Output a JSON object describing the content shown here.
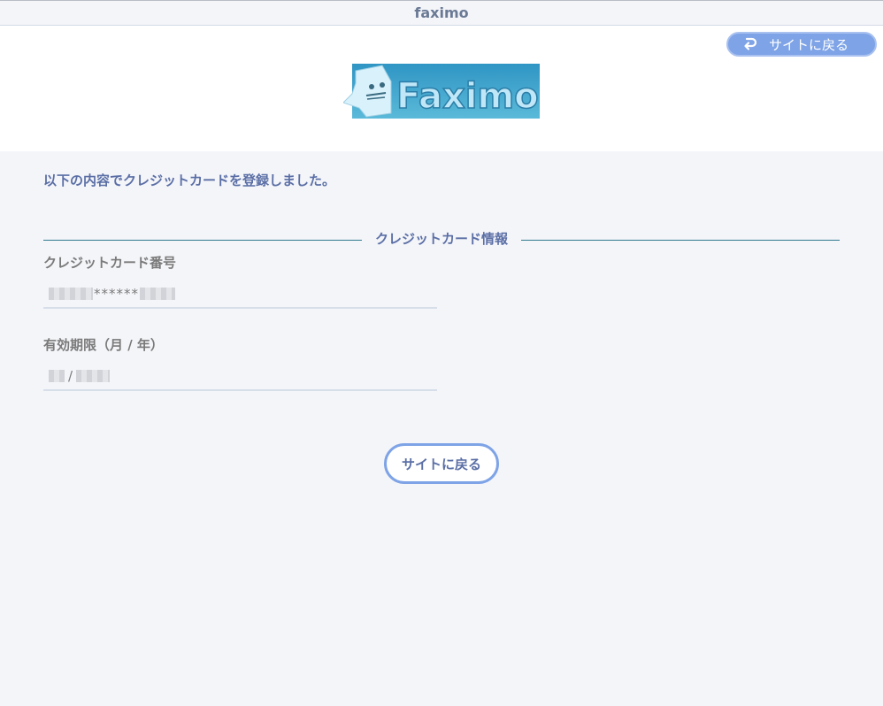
{
  "window": {
    "title": "faximo"
  },
  "header": {
    "back_button_label": "サイトに戻る",
    "logo_text": "Faximo"
  },
  "main": {
    "message": "以下の内容でクレジットカードを登録しました。",
    "section_heading": "クレジットカード情報",
    "card_number": {
      "label": "クレジットカード番号",
      "masked": "******"
    },
    "expiry": {
      "label": "有効期限（月 / 年）",
      "separator": "/"
    },
    "back_button_label": "サイトに戻る"
  },
  "colors": {
    "accent": "#7ea3e6",
    "text_primary": "#5b6fa6",
    "text_muted": "#7a7a7a",
    "rule": "#2f7a91",
    "logo_bg": "#3fa6cf"
  },
  "icons": {
    "back_top": "return-arrow-icon",
    "logo_mascot": "fax-ghost-icon"
  }
}
